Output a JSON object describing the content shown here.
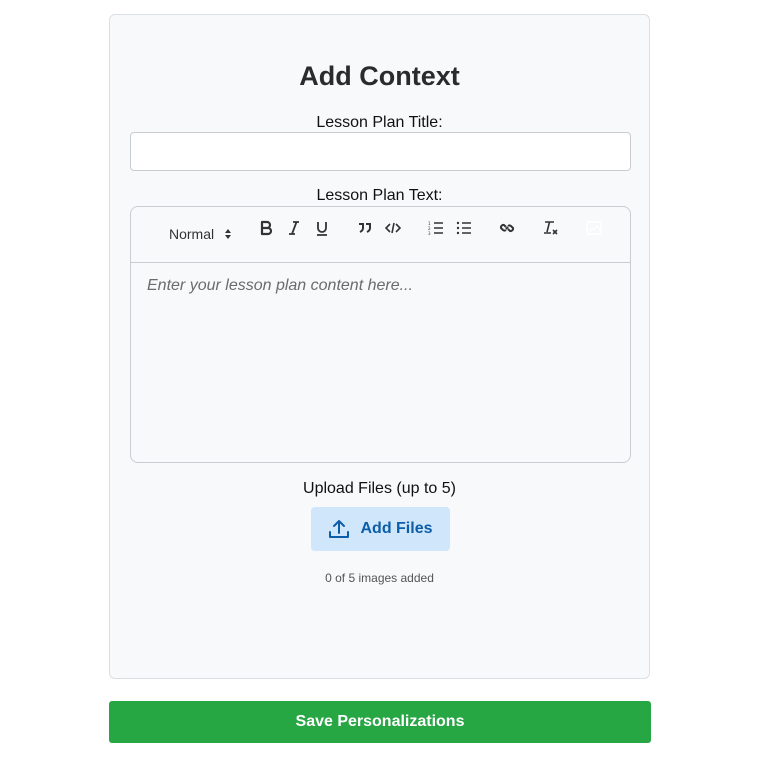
{
  "form": {
    "title": "Add Context",
    "lesson_title_label": "Lesson Plan Title:",
    "lesson_title_value": "",
    "lesson_text_label": "Lesson Plan Text:",
    "editor": {
      "header_select": "Normal",
      "placeholder": "Enter your lesson plan content here...",
      "toolbar_icons": [
        "bold-icon",
        "italic-icon",
        "underline-icon",
        "blockquote-icon",
        "code-block-icon",
        "ordered-list-icon",
        "bullet-list-icon",
        "link-icon",
        "clear-format-icon",
        "image-icon"
      ]
    },
    "upload_label": "Upload Files (up to 5)",
    "add_files_label": "Add Files",
    "images_count": "0 of 5 images added"
  },
  "footer": {
    "save_label": "Save Personalizations"
  },
  "colors": {
    "primary_green": "#27a644",
    "upload_bg": "#cfe6fb",
    "upload_text": "#0d5ea8",
    "card_bg": "#f8f9fb"
  }
}
